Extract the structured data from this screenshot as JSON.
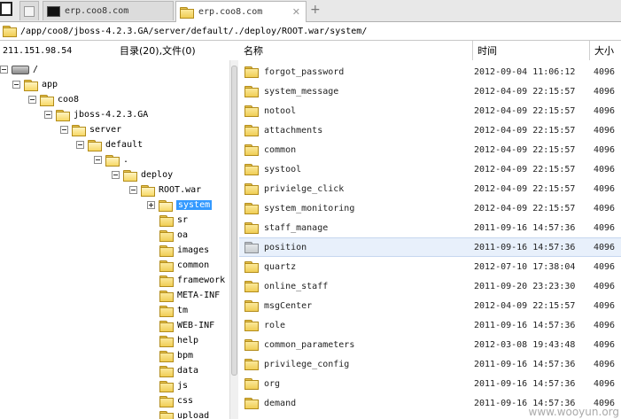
{
  "tabs": [
    {
      "label": ""
    },
    {
      "label": "erp.coo8.com"
    },
    {
      "label": "erp.coo8.com"
    }
  ],
  "path": "/app/coo8/jboss-4.2.3.GA/server/default/./deploy/ROOT.war/system/",
  "info": {
    "ip": "211.151.98.54",
    "count": "目录(20),文件(0)"
  },
  "columns": {
    "name": "名称",
    "time": "时间",
    "size": "大小"
  },
  "tree": [
    {
      "label": "/",
      "drive": true
    },
    {
      "label": "app"
    },
    {
      "label": "coo8"
    },
    {
      "label": "jboss-4.2.3.GA"
    },
    {
      "label": "server"
    },
    {
      "label": "default"
    },
    {
      "label": "."
    },
    {
      "label": "deploy"
    },
    {
      "label": "ROOT.war"
    },
    {
      "label": "system",
      "selected": true
    },
    {
      "label": "sr"
    },
    {
      "label": "oa"
    },
    {
      "label": "images"
    },
    {
      "label": "common"
    },
    {
      "label": "framework"
    },
    {
      "label": "META-INF"
    },
    {
      "label": "tm"
    },
    {
      "label": "WEB-INF"
    },
    {
      "label": "help"
    },
    {
      "label": "bpm"
    },
    {
      "label": "data"
    },
    {
      "label": "js"
    },
    {
      "label": "css"
    },
    {
      "label": "upload"
    }
  ],
  "files": [
    {
      "name": "forgot_password",
      "time": "2012-09-04 11:06:12",
      "size": "4096"
    },
    {
      "name": "system_message",
      "time": "2012-04-09 22:15:57",
      "size": "4096"
    },
    {
      "name": "notool",
      "time": "2012-04-09 22:15:57",
      "size": "4096"
    },
    {
      "name": "attachments",
      "time": "2012-04-09 22:15:57",
      "size": "4096"
    },
    {
      "name": "common",
      "time": "2012-04-09 22:15:57",
      "size": "4096"
    },
    {
      "name": "systool",
      "time": "2012-04-09 22:15:57",
      "size": "4096"
    },
    {
      "name": "privielge_click",
      "time": "2012-04-09 22:15:57",
      "size": "4096"
    },
    {
      "name": "system_monitoring",
      "time": "2012-04-09 22:15:57",
      "size": "4096"
    },
    {
      "name": "staff_manage",
      "time": "2011-09-16 14:57:36",
      "size": "4096"
    },
    {
      "name": "position",
      "time": "2011-09-16 14:57:36",
      "size": "4096",
      "highlight": true
    },
    {
      "name": "quartz",
      "time": "2012-07-10 17:38:04",
      "size": "4096"
    },
    {
      "name": "online_staff",
      "time": "2011-09-20 23:23:30",
      "size": "4096"
    },
    {
      "name": "msgCenter",
      "time": "2012-04-09 22:15:57",
      "size": "4096"
    },
    {
      "name": "role",
      "time": "2011-09-16 14:57:36",
      "size": "4096"
    },
    {
      "name": "common_parameters",
      "time": "2012-03-08 19:43:48",
      "size": "4096"
    },
    {
      "name": "privilege_config",
      "time": "2011-09-16 14:57:36",
      "size": "4096"
    },
    {
      "name": "org",
      "time": "2011-09-16 14:57:36",
      "size": "4096"
    },
    {
      "name": "demand",
      "time": "2011-09-16 14:57:36",
      "size": "4096"
    }
  ],
  "watermark": "www.wooyun.org",
  "icons": {
    "folder": "folder-icon",
    "drive": "drive-icon",
    "new_tab": "plus-icon",
    "close": "close-icon"
  },
  "colors": {
    "selection": "#3399ff",
    "highlight_row": "#e8f0fb",
    "folder": "#f0cd55"
  }
}
